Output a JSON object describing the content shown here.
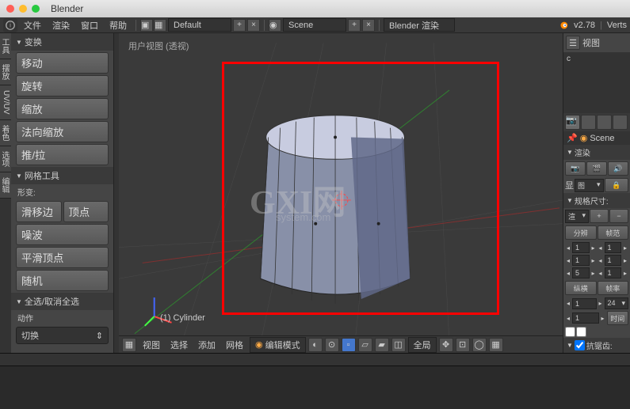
{
  "window": {
    "title": "Blender"
  },
  "menubar": {
    "items": [
      "文件",
      "渲染",
      "窗口",
      "帮助"
    ],
    "layout_dd": "Default",
    "scene_dd": "Scene",
    "engine_dd": "Blender 渲染",
    "version": "v2.78",
    "stats": "Verts"
  },
  "left_tabs": [
    "工具",
    "摆放",
    "UV/UV",
    "着色",
    "选项",
    "编辑"
  ],
  "tools": {
    "transform_header": "变换",
    "transform": [
      "移动",
      "旋转",
      "缩放",
      "法向缩放",
      "推/拉"
    ],
    "mesh_header": "网格工具",
    "deform_label": "形变:",
    "mesh_row1": [
      "滑移边",
      "顶点"
    ],
    "mesh_items": [
      "噪波",
      "平滑顶点",
      "随机"
    ],
    "select_header": "全选/取消全选",
    "action_label": "动作",
    "action_value": "切换"
  },
  "viewport": {
    "view_label": "用户视图 (透视)",
    "object_label": "(1) Cylinder",
    "watermark": "GXI网",
    "watermark_sub": "system.com"
  },
  "viewport_header": {
    "menus": [
      "视图",
      "选择",
      "添加",
      "网格"
    ],
    "mode": "编辑模式",
    "global": "全局"
  },
  "right_panel": {
    "view_header": "视图",
    "view_field": "c",
    "outliner_scene": "Scene",
    "render_header": "渲染",
    "display_label": "显",
    "display_value": "图",
    "dims_header": "规格尺寸:",
    "render_dd": "渲",
    "resolve_btn": "分辨",
    "frame_btn": "帧范",
    "res_x": "1",
    "res_y": "1",
    "res_pct": "5",
    "aspect_label": "纵横",
    "fps_label": "帧率",
    "fps_value": "24",
    "time_label": "时间",
    "antialias": "抗锯齿:"
  }
}
